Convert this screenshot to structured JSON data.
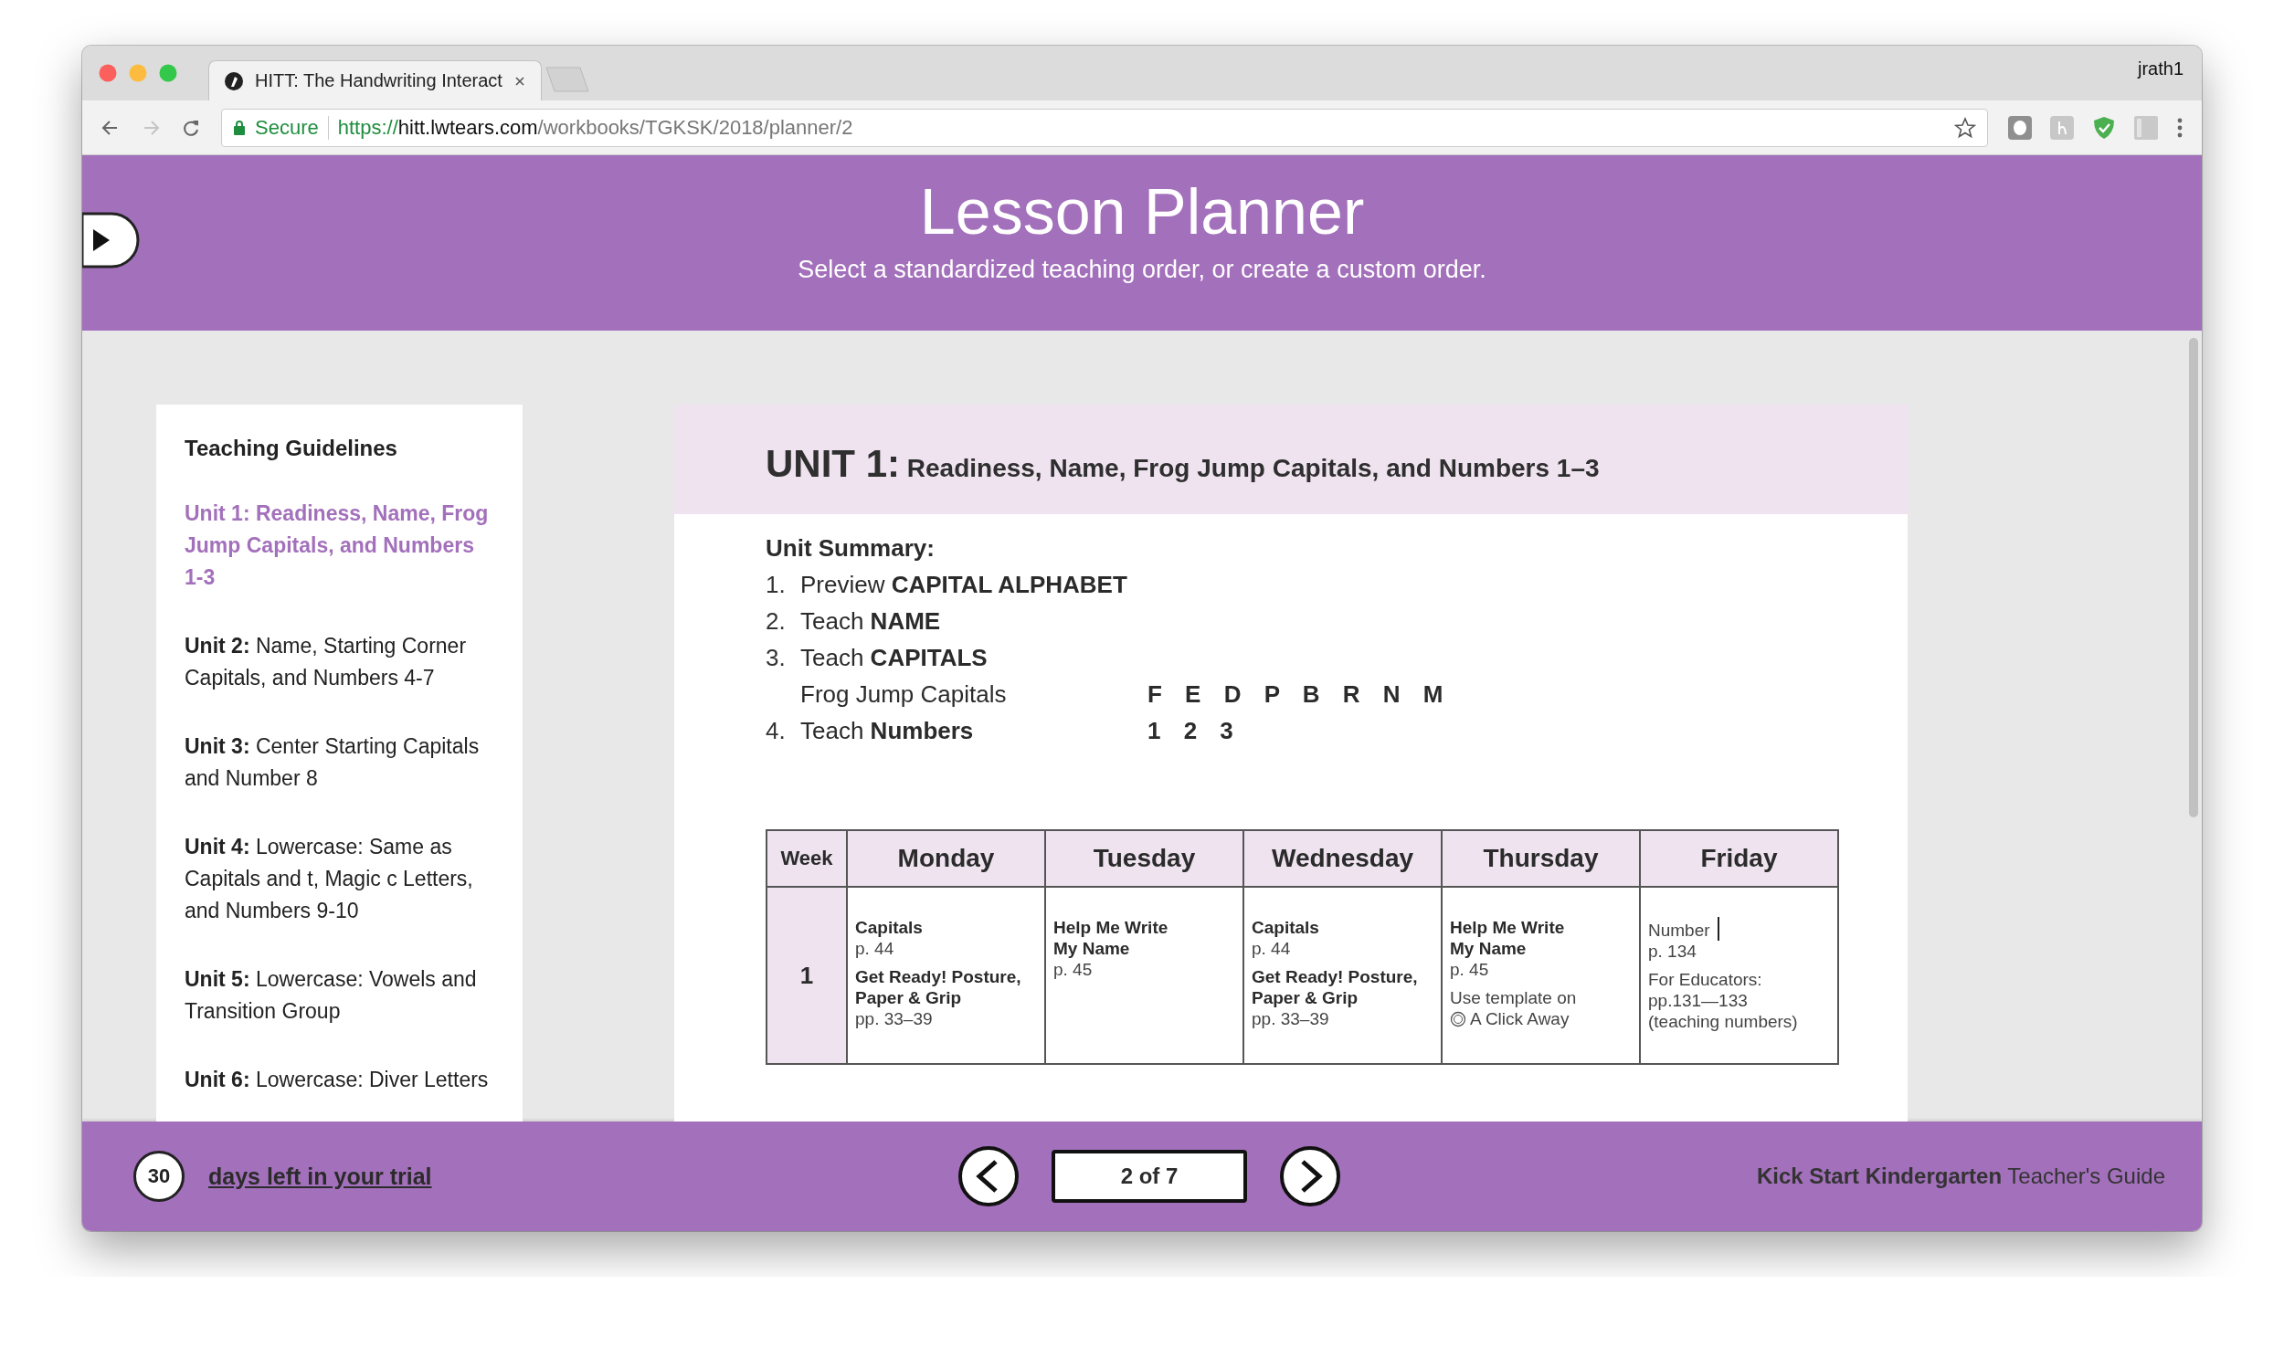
{
  "browser": {
    "tab_title": "HITT: The Handwriting Interact",
    "user": "jrath1",
    "nav": [
      {
        "kind": "back",
        "disabled": false
      },
      {
        "kind": "forward",
        "disabled": true
      },
      {
        "kind": "reload",
        "disabled": false
      }
    ],
    "address": {
      "security": "Secure",
      "scheme": "https://",
      "host": "hitt.lwtears.com",
      "path": "/workbooks/TGKSK/2018/planner/2"
    }
  },
  "header": {
    "title": "Lesson Planner",
    "subtitle": "Select a standardized teaching order, or create a custom order."
  },
  "sidebar": {
    "title": "Teaching Guidelines",
    "items": [
      {
        "label": "Unit 1:",
        "text": "Readiness, Name, Frog Jump Capitals, and Numbers 1-3",
        "selected": true
      },
      {
        "label": "Unit 2:",
        "text": "Name, Starting Corner Capitals, and Numbers 4-7",
        "selected": false
      },
      {
        "label": "Unit 3:",
        "text": "Center Starting Capitals and Number 8",
        "selected": false
      },
      {
        "label": "Unit 4:",
        "text": "Lowercase: Same as Capitals and t, Magic c Letters, and Numbers 9-10",
        "selected": false
      },
      {
        "label": "Unit 5:",
        "text": "Lowercase: Vowels and Transition Group",
        "selected": false
      },
      {
        "label": "Unit 6:",
        "text": "Lowercase: Diver Letters",
        "selected": false
      }
    ]
  },
  "document": {
    "unit_label": "UNIT 1:",
    "unit_title": "Readiness, Name, Frog Jump Capitals, and Numbers 1–3",
    "summary_title": "Unit Summary:",
    "summary": [
      {
        "number": "1.",
        "text": "Preview **CAPITAL ALPHABET**"
      },
      {
        "number": "2.",
        "text": "Teach **NAME**"
      },
      {
        "number": "3.",
        "text": "Teach **CAPITALS**",
        "subtext": "Frog Jump Capitals",
        "detail": "F E D P B R N M"
      },
      {
        "number": "4.",
        "text": "Teach **Numbers**",
        "detail": "1 2 3"
      }
    ],
    "table": {
      "columns": [
        "Week",
        "Monday",
        "Tuesday",
        "Wednesday",
        "Thursday",
        "Friday"
      ],
      "rows": [
        {
          "cells": [
            [
              {
                "kind": "week",
                "text": "1"
              }
            ],
            [
              {
                "kind": "heading",
                "text": "Capitals"
              },
              {
                "kind": "text",
                "text": "p. 44"
              },
              {
                "kind": "heading",
                "text": "Get Ready! Posture,\nPaper & Grip"
              },
              {
                "kind": "text",
                "text": "pp. 33–39"
              }
            ],
            [
              {
                "kind": "heading",
                "text": "Help Me Write\nMy Name"
              },
              {
                "kind": "text",
                "text": "p. 45"
              }
            ],
            [
              {
                "kind": "heading",
                "text": "Capitals"
              },
              {
                "kind": "text",
                "text": "p. 44"
              },
              {
                "kind": "heading",
                "text": "Get Ready! Posture,\nPaper & Grip"
              },
              {
                "kind": "text",
                "text": "pp. 33–39"
              }
            ],
            [
              {
                "kind": "heading",
                "text": "Help Me Write\nMy Name"
              },
              {
                "kind": "text",
                "text": "p. 45"
              },
              {
                "kind": "note",
                "text": "Use template on"
              },
              {
                "kind": "resource",
                "text": "A Click Away"
              }
            ],
            [
              {
                "kind": "input",
                "text": "Number"
              },
              {
                "kind": "text",
                "text": "p. 134"
              },
              {
                "kind": "note",
                "text": "For Educators:\npp.131—133\n(teaching numbers)"
              }
            ]
          ]
        }
      ]
    }
  },
  "footer": {
    "days": "30",
    "trial_link": "days left in your trial",
    "page": "2 of 7",
    "book_title": "Kick Start Kindergarten",
    "book_subtitle": "Teacher's Guide"
  }
}
